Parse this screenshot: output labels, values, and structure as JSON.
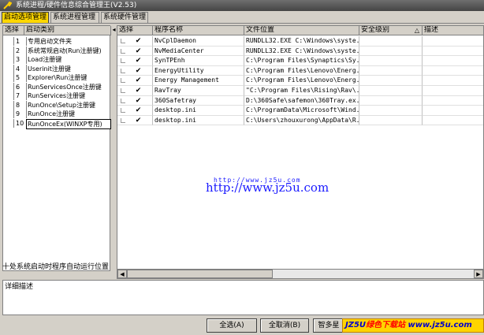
{
  "window": {
    "title": "系统进程/硬件信息综合管理王(V2.53)"
  },
  "tabs": [
    {
      "label": "启动选项管理",
      "active": true
    },
    {
      "label": "系统进程管理",
      "active": false
    },
    {
      "label": "系统硬件管理",
      "active": false
    }
  ],
  "left_table": {
    "headers": [
      "选择",
      "启动类别"
    ],
    "rows": [
      {
        "num": "1",
        "name": "专用启动文件夹"
      },
      {
        "num": "2",
        "name": "系统常规启动(Run注册键)"
      },
      {
        "num": "3",
        "name": "Load注册键"
      },
      {
        "num": "4",
        "name": "Userinit注册键"
      },
      {
        "num": "5",
        "name": "Explorer\\Run注册键"
      },
      {
        "num": "6",
        "name": "RunServicesOnce注册键"
      },
      {
        "num": "7",
        "name": "RunServices注册键"
      },
      {
        "num": "8",
        "name": "RunOnce\\Setup注册键"
      },
      {
        "num": "9",
        "name": "RunOnce注册键"
      },
      {
        "num": "10",
        "name": "RunOnceEx(WINXP专用)"
      }
    ],
    "footer": "十处系统启动时程序自动运行位置"
  },
  "right_table": {
    "headers": [
      "选择",
      "程序名称",
      "文件位置",
      "安全级别",
      "描述"
    ],
    "rows": [
      {
        "checked": "✔",
        "name": "NvCplDaemon",
        "path": "RUNDLL32.EXE C:\\Windows\\syste..."
      },
      {
        "checked": "✔",
        "name": "NvMediaCenter",
        "path": "RUNDLL32.EXE C:\\Windows\\syste..."
      },
      {
        "checked": "✔",
        "name": "SynTPEnh",
        "path": "C:\\Program Files\\Synaptics\\Sy..."
      },
      {
        "checked": "✔",
        "name": "EnergyUtility",
        "path": "C:\\Program Files\\Lenovo\\Energ..."
      },
      {
        "checked": "✔",
        "name": "Energy Management",
        "path": "C:\\Program Files\\Lenovo\\Energ..."
      },
      {
        "checked": "✔",
        "name": "RavTray",
        "path": "\"C:\\Program Files\\Rising\\Rav\\..."
      },
      {
        "checked": "✔",
        "name": "360Safetray",
        "path": "D:\\360Safe\\safemon\\360Tray.ex..."
      },
      {
        "checked": "✔",
        "name": "desktop.ini",
        "path": "C:\\ProgramData\\Microsoft\\Wind..."
      },
      {
        "checked": "✔",
        "name": "desktop.ini",
        "path": "C:\\Users\\zhouxurong\\AppData\\R..."
      }
    ]
  },
  "watermark": {
    "main": "http://www.jz5u.com",
    "small": "http://www.jz5u.com"
  },
  "detail": {
    "label": "详细描述"
  },
  "buttons": {
    "select_all": "全选(A)",
    "deselect_all": "全取消(B)",
    "more": "智多星"
  },
  "banner": {
    "part1": "JZ5U",
    "part2": "绿色下载站",
    "part3": "www.jz5u.com"
  },
  "icons": {
    "sort": "sort-triangle-icon",
    "app": "wrench-icon"
  },
  "colors": {
    "active_tab": "#ffd700",
    "titlebar": "#555555",
    "watermark": "#1a1aff",
    "banner_bg": "#ffd400"
  }
}
